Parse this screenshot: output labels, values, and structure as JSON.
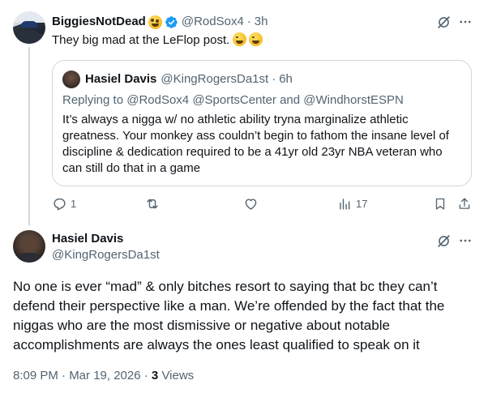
{
  "reply_tweet": {
    "display_name": "BiggiesNotDead",
    "emoji_1": "zany-face-emoji",
    "emoji_2": "verified-badge",
    "handle": "@RodSox4",
    "separator": "·",
    "time": "3h",
    "text": "They big mad at the LeFlop post.",
    "text_emojis": [
      "rofl-emoji",
      "rofl-emoji"
    ],
    "quoted": {
      "display_name": "Hasiel Davis",
      "handle": "@KingRogersDa1st",
      "separator": "·",
      "time": "6h",
      "replying_to": "Replying to @RodSox4 @SportsCenter and @WindhorstESPN",
      "lines": [
        "It’s always a nigga w/ no athletic ability tryna marginalize athletic",
        "greatness. Your monkey ass couldn’t begin to fathom the insane level of",
        "discipline & dedication required to be a 41yr old 23yr NBA veteran who",
        "can still do that in a game"
      ]
    },
    "actions": {
      "reply_count": "1",
      "retweet_count": "",
      "like_count": "",
      "views_count": "17"
    }
  },
  "main_tweet": {
    "display_name": "Hasiel Davis",
    "handle": "@KingRogersDa1st",
    "lines": [
      "No one is ever “mad” & only bitches resort to saying that bc they can’t",
      "defend their perspective like a man. We’re offended by the fact that the",
      "niggas who are the most dismissive or negative about notable",
      "accomplishments are always the ones least qualified to speak on it"
    ],
    "timestamp": "8:09 PM · Mar 19, 2026 ·",
    "views_count": "3",
    "views_label": "Views"
  },
  "colors": {
    "text": "#0f1419",
    "secondary": "#536471",
    "border": "#cfd9de",
    "verified": "#1d9bf0"
  },
  "icons": {
    "grok": "grok-icon",
    "more": "more-icon",
    "reply": "reply-icon",
    "retweet": "retweet-icon",
    "like": "heart-icon",
    "views": "views-icon",
    "bookmark": "bookmark-icon",
    "share": "share-icon"
  }
}
